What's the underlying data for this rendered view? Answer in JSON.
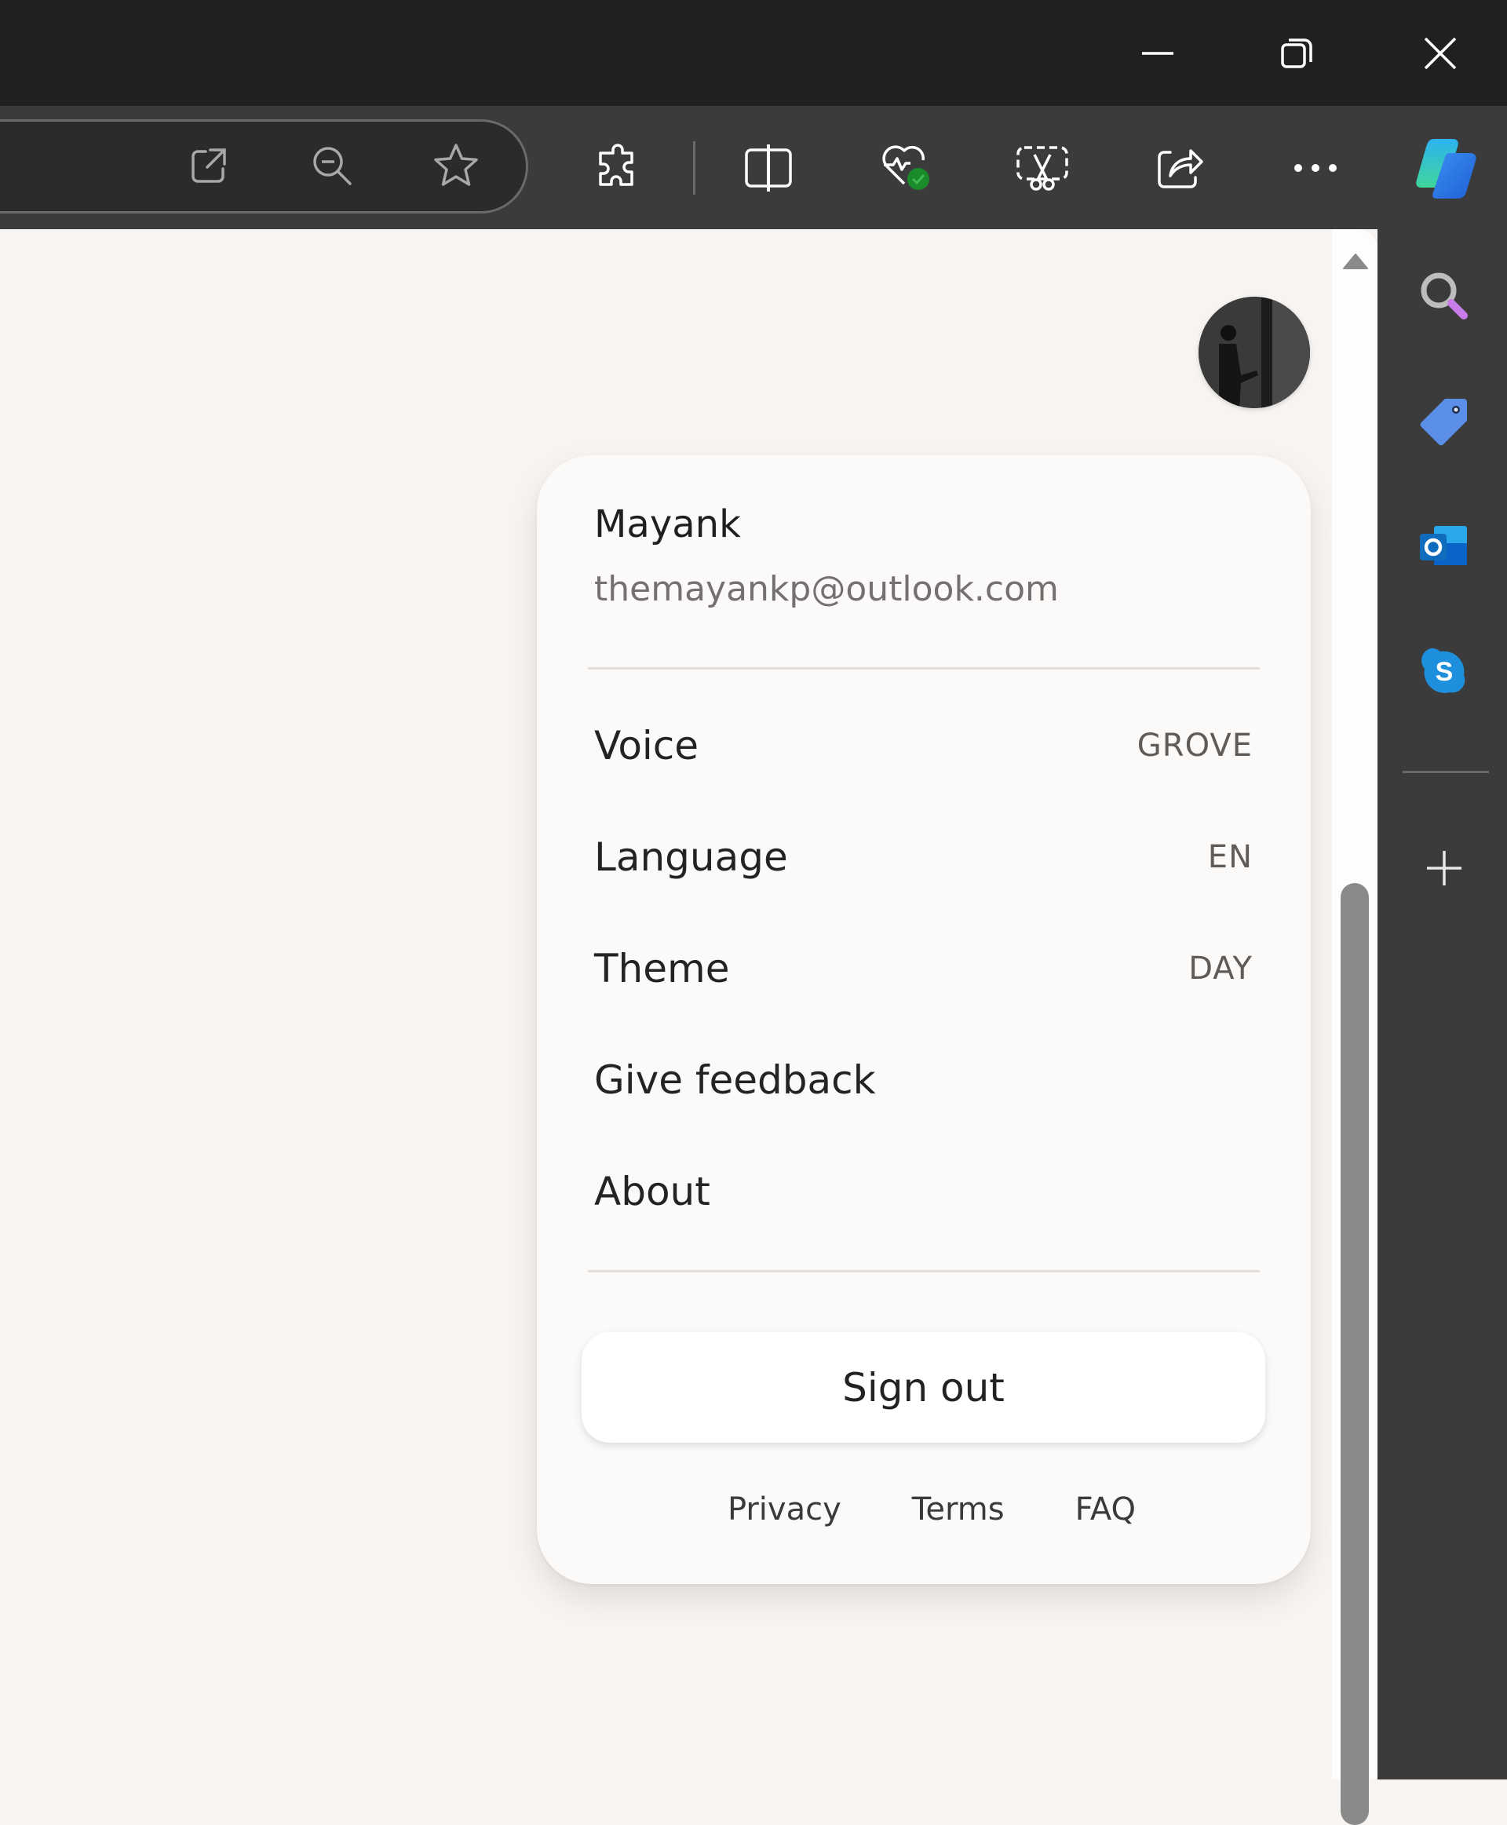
{
  "window": {
    "controls": {
      "minimize": "minimize",
      "restore": "restore",
      "close": "close"
    }
  },
  "toolbar": {
    "address_bar_icons": [
      "open-in-app-icon",
      "zoom-out-icon",
      "favorite-star-icon"
    ],
    "icons": [
      "extensions-icon",
      "split-screen-icon",
      "browser-essentials-icon",
      "screenshot-icon",
      "share-icon",
      "more-options-icon",
      "copilot-icon"
    ]
  },
  "sidebar": {
    "items": [
      "search",
      "shopping",
      "outlook",
      "skype"
    ],
    "add_label": "+"
  },
  "profile_menu": {
    "user_name": "Mayank",
    "user_email": "themayankp@outlook.com",
    "items": [
      {
        "label": "Voice",
        "value": "GROVE"
      },
      {
        "label": "Language",
        "value": "EN"
      },
      {
        "label": "Theme",
        "value": "DAY"
      },
      {
        "label": "Give feedback",
        "value": ""
      },
      {
        "label": "About",
        "value": ""
      }
    ],
    "sign_out_label": "Sign out",
    "footer_links": [
      "Privacy",
      "Terms",
      "FAQ"
    ]
  },
  "colors": {
    "titlebar": "#202020",
    "toolbar": "#3b3b3b",
    "page_background": "#f7f4f1",
    "card_background": "#fcfaf8",
    "health_badge": "#1a8a2a"
  }
}
